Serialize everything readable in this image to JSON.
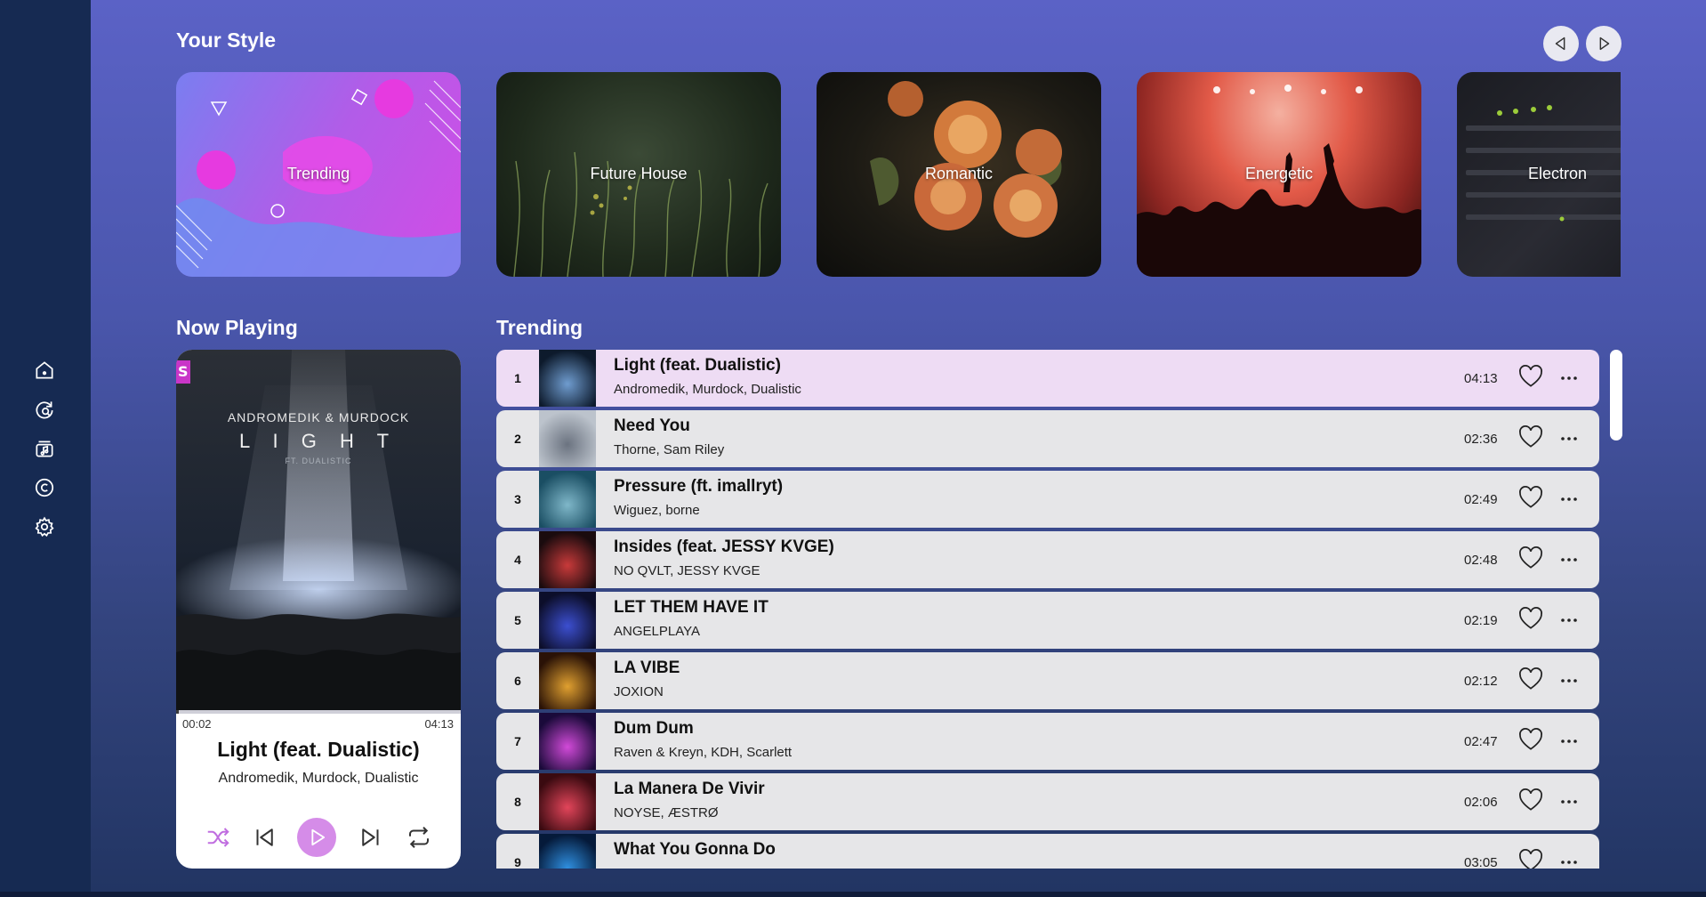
{
  "sidebar": {
    "icons": [
      "home-icon",
      "search-refresh-icon",
      "music-library-icon",
      "copyright-icon",
      "settings-icon"
    ]
  },
  "your_style": {
    "title": "Your Style",
    "cards": [
      {
        "label": "Trending"
      },
      {
        "label": "Future House"
      },
      {
        "label": "Romantic"
      },
      {
        "label": "Energetic"
      },
      {
        "label": "Electron"
      }
    ]
  },
  "now_playing": {
    "title": "Now Playing",
    "art_line1": "ANDROMEDIK & MURDOCK",
    "art_line2": "L I G H T",
    "art_line3": "FT. DUALISTIC",
    "elapsed": "00:02",
    "duration": "04:13",
    "progress": 0.008,
    "track_title": "Light (feat. Dualistic)",
    "artists": "Andromedik, Murdock, Dualistic"
  },
  "trending": {
    "title": "Trending",
    "tracks": [
      {
        "num": "1",
        "title": "Light (feat. Dualistic)",
        "artist": "Andromedik, Murdock, Dualistic",
        "duration": "04:13",
        "active": true,
        "thumb": [
          "#0d1a2c",
          "#6f9ccf"
        ]
      },
      {
        "num": "2",
        "title": "Need You",
        "artist": "Thorne, Sam Riley",
        "duration": "02:36",
        "active": false,
        "thumb": [
          "#bcc3cc",
          "#6b7380"
        ]
      },
      {
        "num": "3",
        "title": "Pressure (ft. imallryt)",
        "artist": "Wiguez, borne",
        "duration": "02:49",
        "active": false,
        "thumb": [
          "#1a4e63",
          "#7fb7c9"
        ]
      },
      {
        "num": "4",
        "title": "Insides (feat. JESSY KVGE)",
        "artist": "NO QVLT, JESSY KVGE",
        "duration": "02:48",
        "active": false,
        "thumb": [
          "#1a0b0e",
          "#c83a3a"
        ]
      },
      {
        "num": "5",
        "title": "LET THEM HAVE IT",
        "artist": "ANGELPLAYA",
        "duration": "02:19",
        "active": false,
        "thumb": [
          "#0c0e2a",
          "#3c4fd0"
        ]
      },
      {
        "num": "6",
        "title": "LA VIBE",
        "artist": "JOXION",
        "duration": "02:12",
        "active": false,
        "thumb": [
          "#2a1206",
          "#e0a030"
        ]
      },
      {
        "num": "7",
        "title": "Dum Dum",
        "artist": "Raven & Kreyn, KDH, Scarlett",
        "duration": "02:47",
        "active": false,
        "thumb": [
          "#1a0a3a",
          "#d14ad8"
        ]
      },
      {
        "num": "8",
        "title": "La Manera De Vivir",
        "artist": "NOYSE, ÆSTRØ",
        "duration": "02:06",
        "active": false,
        "thumb": [
          "#3a0a10",
          "#e2455a"
        ]
      },
      {
        "num": "9",
        "title": "What You Gonna Do",
        "artist": "",
        "duration": "03:05",
        "active": false,
        "thumb": [
          "#051a3a",
          "#2f8fe0"
        ]
      }
    ]
  },
  "colors": {
    "accent": "#d58ce8",
    "active_row": "#eedcf4",
    "row": "#e6e6e8"
  }
}
